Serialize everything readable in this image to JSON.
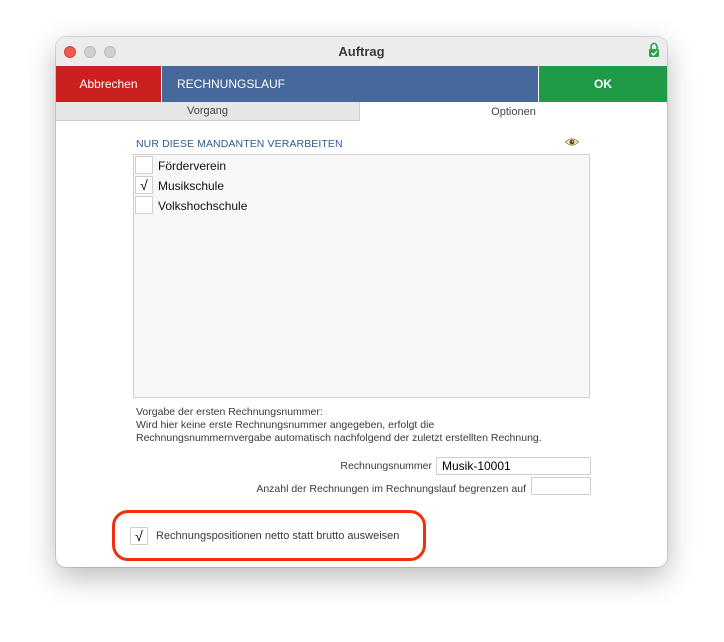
{
  "window": {
    "title": "Auftrag"
  },
  "actionbar": {
    "cancel_label": "Abbrechen",
    "title_label": "RECHNUNGSLAUF",
    "ok_label": "OK",
    "colors": {
      "cancel": "#cc1f1f",
      "banner": "#46689a",
      "ok": "#1f9a47"
    }
  },
  "tabs": [
    {
      "label": "Vorgang",
      "selected": false
    },
    {
      "label": "Optionen",
      "selected": true
    }
  ],
  "mandanten": {
    "heading": "NUR DIESE MANDANTEN VERARBEITEN",
    "visibility_icon": "eye-icon",
    "items": [
      {
        "label": "Förderverein",
        "checked": false,
        "mark": ""
      },
      {
        "label": "Musikschule",
        "checked": true,
        "mark": "√"
      },
      {
        "label": "Volkshochschule",
        "checked": false,
        "mark": ""
      }
    ]
  },
  "info": {
    "line1": "Vorgabe der ersten Rechnungsnummer:",
    "line2": "Wird hier keine erste Rechnungsnummer angegeben, erfolgt die",
    "line3": "Rechnungsnummernvergabe automatisch nachfolgend der zuletzt erstellten Rechnung."
  },
  "fields": {
    "rechnungsnummer_label": "Rechnungsnummer",
    "rechnungsnummer_value": "Musik-10001",
    "anzahl_label": "Anzahl der Rechnungen im Rechnungslauf begrenzen auf",
    "anzahl_value": ""
  },
  "netto_option": {
    "label": "Rechnungspositionen netto statt brutto ausweisen",
    "checked": true,
    "mark": "√"
  }
}
